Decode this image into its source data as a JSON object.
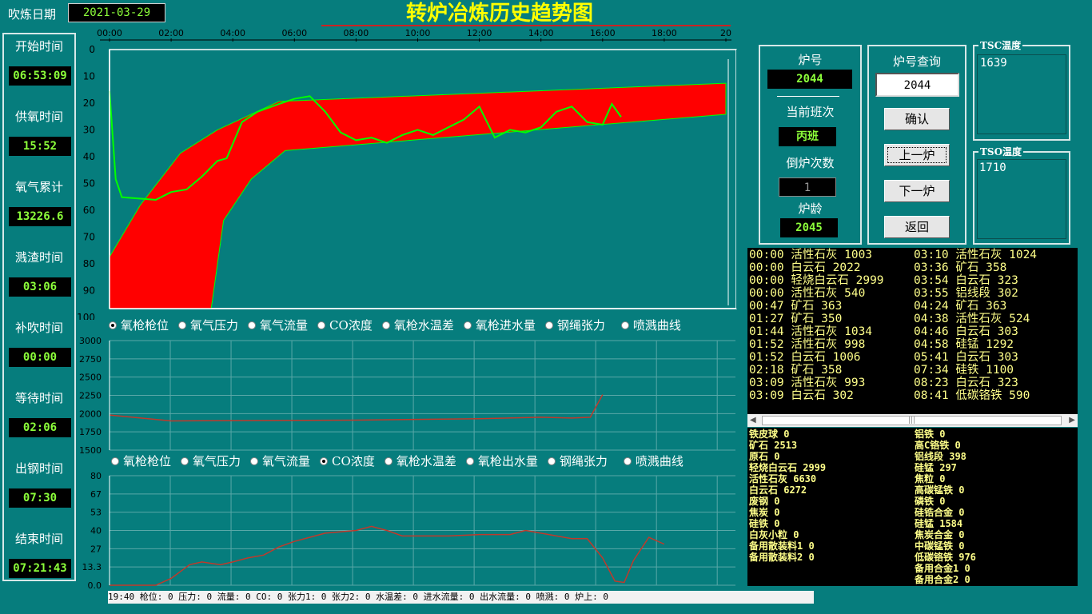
{
  "header": {
    "date_label": "吹炼日期",
    "date_value": "2021-03-29",
    "title": "转炉冶炼历史趋势图"
  },
  "sidebar": {
    "items": [
      {
        "label": "开始时间",
        "value": "06:53:09"
      },
      {
        "label": "供氧时间",
        "value": "15:52"
      },
      {
        "label": "氧气累计",
        "value": "13226.6"
      },
      {
        "label": "溅渣时间",
        "value": "03:06"
      },
      {
        "label": "补吹时间",
        "value": "00:00"
      },
      {
        "label": "等待时间",
        "value": "02:06"
      },
      {
        "label": "出钢时间",
        "value": "07:30"
      },
      {
        "label": "结束时间",
        "value": "07:21:43"
      }
    ]
  },
  "info_panel": {
    "furnace_no_label": "炉号",
    "furnace_no": "2044",
    "shift_label": "当前班次",
    "shift": "丙班",
    "tap_count_label": "倒炉次数",
    "tap_count": "1",
    "age_label": "炉龄",
    "age": "2045"
  },
  "query_panel": {
    "label": "炉号查询",
    "input_value": "2044",
    "confirm": "确认",
    "prev": "上一炉",
    "next": "下一炉",
    "back": "返回"
  },
  "temps": {
    "tsc_label": "TSC温度",
    "tsc_value": "1639",
    "tso_label": "TSO温度",
    "tso_value": "1710"
  },
  "additions": [
    "00:00 活性石灰 1003",
    "03:10 活性石灰 1024",
    "00:00 白云石 2022",
    "03:36 矿石 358",
    "00:00 轻烧白云石 2999",
    "03:54 白云石 323",
    "00:00 活性石灰 540",
    "03:55 铝线段 302",
    "00:47 矿石 363",
    "04:24 矿石 363",
    "01:27 矿石 350",
    "04:38 活性石灰 524",
    "01:44 活性石灰 1034",
    "04:46 白云石 303",
    "01:52 活性石灰 998",
    "04:58 硅锰 1292",
    "01:52 白云石 1006",
    "05:41 白云石 303",
    "02:18 矿石 358",
    "07:34 硅铁 1100",
    "03:09 活性石灰 993",
    "08:23 白云石 323",
    "03:09 白云石 302",
    "08:41 低碳铬铁 590"
  ],
  "materials_left": [
    "铁皮球 0",
    "矿石 2513",
    "原石 0",
    "轻烧白云石 2999",
    "活性石灰 6630",
    "白云石 6272",
    "废钢 0",
    "焦炭 0",
    "硅铁 0",
    "白灰小粒 0",
    "备用散装料1 0",
    "备用散装料2 0"
  ],
  "materials_right": [
    "铝铁 0",
    "高C铬铁 0",
    "铝线段 398",
    "硅锰 297",
    "焦粒 0",
    "高碳锰铁 0",
    "磷铁 0",
    "硅锆合金 0",
    "硅锰 1584",
    "焦炭合金 0",
    "中碳锰铁 0",
    "低碳铬铁 976",
    "备用合金1 0",
    "备用合金2 0"
  ],
  "chart1_options": [
    "氧枪枪位",
    "氧气压力",
    "氧气流量",
    "CO浓度",
    "氧枪水温差",
    "氧枪进水量",
    "钢绳张力",
    "喷溅曲线"
  ],
  "chart1_selected": 0,
  "chart2_options": [
    "氧枪枪位",
    "氧气压力",
    "氧气流量",
    "CO浓度",
    "氧枪水温差",
    "氧枪出水量",
    "钢绳张力",
    "喷溅曲线"
  ],
  "chart2_selected": 3,
  "status_text": "19:40 枪位: 0 压力: 0 流量: 0 CO: 0 张力1: 0 张力2: 0 水温差: 0 进水流量: 0 出水流量: 0 喷溅: 0 炉上: 0",
  "chart_data": [
    {
      "type": "area",
      "time_ticks": [
        "00:00",
        "02:00",
        "04:00",
        "06:00",
        "08:00",
        "10:00",
        "12:00",
        "14:00",
        "16:00",
        "18:00",
        "20"
      ],
      "y_ticks": [
        "0",
        "10",
        "20",
        "30",
        "40",
        "50",
        "60",
        "70",
        "80",
        "90",
        "100"
      ],
      "ylim": [
        0,
        100
      ],
      "y_inverted": true,
      "xlim_minutes": [
        0,
        20
      ],
      "band_upper": [
        [
          0,
          80
        ],
        [
          1,
          60
        ],
        [
          2.3,
          40
        ],
        [
          3.5,
          31
        ],
        [
          5.5,
          20
        ],
        [
          20,
          13
        ]
      ],
      "band_lower": [
        [
          0,
          100
        ],
        [
          3.3,
          100
        ],
        [
          3.7,
          66
        ],
        [
          4.6,
          50
        ],
        [
          5.7,
          39
        ],
        [
          20,
          25
        ]
      ],
      "lance_line": [
        [
          0,
          16
        ],
        [
          0.2,
          50
        ],
        [
          0.4,
          57
        ],
        [
          1.5,
          58
        ],
        [
          2,
          55
        ],
        [
          2.5,
          54
        ],
        [
          3,
          49
        ],
        [
          3.5,
          43
        ],
        [
          3.8,
          42
        ],
        [
          4.3,
          28
        ],
        [
          4.8,
          24
        ],
        [
          5.5,
          21
        ],
        [
          6,
          19
        ],
        [
          6.5,
          18
        ],
        [
          7,
          24
        ],
        [
          7.5,
          32
        ],
        [
          8,
          35
        ],
        [
          8.5,
          34
        ],
        [
          9,
          36
        ],
        [
          9.5,
          33
        ],
        [
          10,
          31
        ],
        [
          10.5,
          33
        ],
        [
          11,
          30
        ],
        [
          11.5,
          27
        ],
        [
          12,
          22
        ],
        [
          12.5,
          34
        ],
        [
          13,
          31
        ],
        [
          13.5,
          32
        ],
        [
          14,
          30
        ],
        [
          14.5,
          24
        ],
        [
          15,
          22
        ],
        [
          15.5,
          28
        ],
        [
          16,
          29
        ],
        [
          16.3,
          21
        ],
        [
          16.6,
          26
        ]
      ],
      "band_color": "#ff0000",
      "line_color": "#00ff00"
    },
    {
      "type": "line",
      "y_ticks": [
        "3000",
        "2750",
        "2500",
        "2250",
        "2000",
        "1750",
        "1500"
      ],
      "ylim": [
        1500,
        3000
      ],
      "series": [
        {
          "values": [
            [
              0,
              1980
            ],
            [
              2,
              1900
            ],
            [
              8,
              1910
            ],
            [
              12,
              1930
            ],
            [
              14,
              1950
            ],
            [
              15,
              1940
            ],
            [
              15.6,
              1950
            ],
            [
              16,
              2260
            ]
          ]
        }
      ],
      "line_color": "#c0392b"
    },
    {
      "type": "line",
      "y_ticks": [
        "80",
        "67",
        "53",
        "40",
        "27",
        "13.3",
        "0.0"
      ],
      "ylim": [
        0,
        80
      ],
      "series": [
        {
          "values": [
            [
              0,
              0
            ],
            [
              1.5,
              0
            ],
            [
              2,
              5
            ],
            [
              2.6,
              15
            ],
            [
              3,
              17
            ],
            [
              3.6,
              15
            ],
            [
              4,
              17
            ],
            [
              4.5,
              20
            ],
            [
              5,
              22
            ],
            [
              5.5,
              28
            ],
            [
              6,
              32
            ],
            [
              7,
              38
            ],
            [
              8,
              40
            ],
            [
              8.5,
              43
            ],
            [
              9,
              40
            ],
            [
              9.5,
              36
            ],
            [
              10,
              36
            ],
            [
              11,
              36
            ],
            [
              12,
              37
            ],
            [
              13,
              37
            ],
            [
              13.5,
              40
            ],
            [
              14,
              38
            ],
            [
              15,
              34
            ],
            [
              15.5,
              34
            ],
            [
              16,
              20
            ],
            [
              16.4,
              3
            ],
            [
              16.7,
              2
            ],
            [
              17,
              18
            ],
            [
              17.5,
              35
            ],
            [
              18,
              30
            ]
          ]
        }
      ],
      "line_color": "#c0392b"
    }
  ]
}
